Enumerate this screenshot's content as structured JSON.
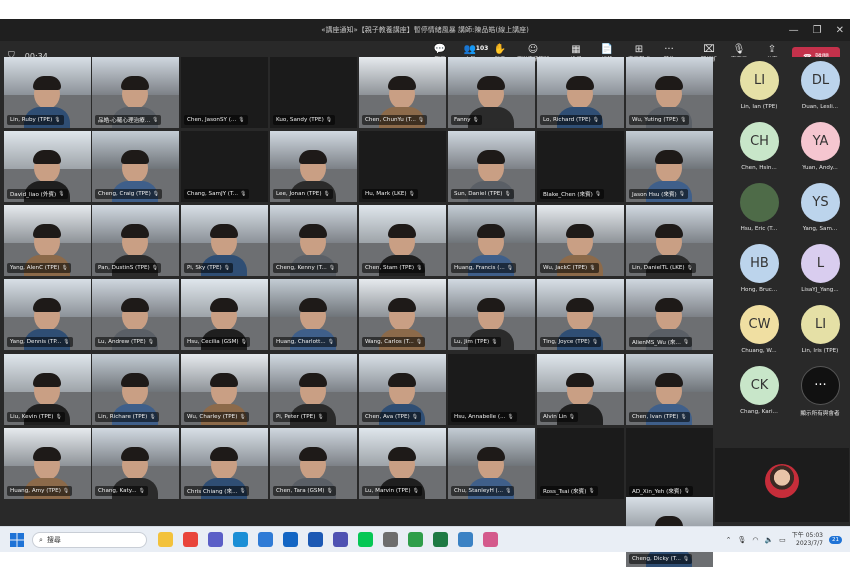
{
  "window": {
    "title": "«講座通知»【親子教養講座】暫停情緒風暴 講師:陳品皓(線上講座)",
    "minimize": "—",
    "restore": "❐",
    "close": "✕"
  },
  "toolbar": {
    "timer": "00:34",
    "buttons": [
      {
        "label": "聊天",
        "icon": "chat-icon"
      },
      {
        "label": "人員",
        "icon": "people-icon",
        "badge": "103"
      },
      {
        "label": "舉手",
        "icon": "raise-hand-icon"
      },
      {
        "label": "傳送表情符號",
        "icon": "reaction-icon"
      },
      {
        "label": "檢視",
        "icon": "view-icon"
      },
      {
        "label": "記錄",
        "icon": "notes-icon"
      },
      {
        "label": "應用程式",
        "icon": "apps-icon"
      },
      {
        "label": "其他",
        "icon": "more-icon"
      },
      {
        "label": "照相機",
        "icon": "camera-off-icon"
      },
      {
        "label": "麥克風",
        "icon": "mic-off-icon"
      },
      {
        "label": "分享",
        "icon": "share-icon"
      }
    ],
    "leave_label": "離開"
  },
  "tiles": [
    [
      "Lin, Ruby (TPE)",
      "品皓-心羅心理治療...",
      "Chen, JasonSY (...",
      "Kuo, Sandy (TPE)",
      "Chen, ChunYu (T...",
      "Fanny",
      "Lo, Richard (TPE)",
      "Wu, Yuting (TPE)"
    ],
    [
      "David_liao (外賓)",
      "Cheng, Craig (TPE)",
      "Chang, SamJY (T...",
      "Lee, Jonan (TPE)",
      "Hu, Mark (LKE)",
      "Sun, Daniel (TPE)",
      "Blake_Chen (來賓)",
      "Jason Hsu (來賓)"
    ],
    [
      "Yang, AlenC (TPE)",
      "Pan, DustinS (TPE)",
      "Pi, Sky (TPE)",
      "Cheng, Kenny (T...",
      "Chen, Stam (TPE)",
      "Huang, Francis (...",
      "Wu, JackC (TPE)",
      "Lin, DanielTL (LKE)"
    ],
    [
      "Yang, Dennis (TP...",
      "Lu, Andrew (TPE)",
      "Hsu, Cecilia (GSM)",
      "Huang, Charlott...",
      "Wang, Carlos (T...",
      "Lu, Jim (TPE)",
      "Ting, Joyce (TPE)",
      "AlienMS_Wu (來..."
    ],
    [
      "Liu, Kevin (TPE)",
      "Lin, Richare (TPE)",
      "Wu, Charley (TPE)",
      "Pi, Peter (TPE)",
      "Chen, Ava (TPE)",
      "Hsu, Annabelle (...",
      "Alvin Lin",
      "Chen, Ivan (TPE)"
    ],
    [
      "Huang, Amy (TPE)",
      "Chang, Katy...",
      "Chris Chiang (來...",
      "Chen, Tara (GSM)",
      "Lu, Marvin (TPE)",
      "Chu, StanleyH (...",
      "Ross_Tsai (來賓)",
      "AD_Xin_Yeh (來賓)",
      "Cheng, Dicky (T..."
    ]
  ],
  "panel": [
    {
      "initials": "LI",
      "name": "Lin, Ian (TPE)",
      "color": "#e5e0a6"
    },
    {
      "initials": "DL",
      "name": "Duan, Lesli...",
      "color": "#bcd4ec"
    },
    {
      "initials": "CH",
      "name": "Chen, Hsin...",
      "color": "#c8e6c9"
    },
    {
      "initials": "YA",
      "name": "Yuan, Andy...",
      "color": "#f5c6d0"
    },
    {
      "initials": "",
      "name": "Hsu, Eric (T...",
      "color": "#4e6b48"
    },
    {
      "initials": "YS",
      "name": "Yang, Sam...",
      "color": "#bcd4ec"
    },
    {
      "initials": "HB",
      "name": "Hong, Bruc...",
      "color": "#bcd4ec"
    },
    {
      "initials": "L",
      "name": "LisaYJ_Yang...",
      "color": "#d9cdef"
    },
    {
      "initials": "CW",
      "name": "Chuang, W...",
      "color": "#f0dfa2"
    },
    {
      "initials": "LI",
      "name": "Lin, Iris (TPE)",
      "color": "#e5e0a6"
    },
    {
      "initials": "CK",
      "name": "Chang, Kari...",
      "color": "#c8e6c9"
    },
    {
      "initials": "···",
      "name": "顯示所有與會者",
      "color": "#111111"
    }
  ],
  "taskbar": {
    "search_placeholder": "搜尋",
    "time": "下午 05:03",
    "date": "2023/7/7",
    "notif": "21"
  }
}
